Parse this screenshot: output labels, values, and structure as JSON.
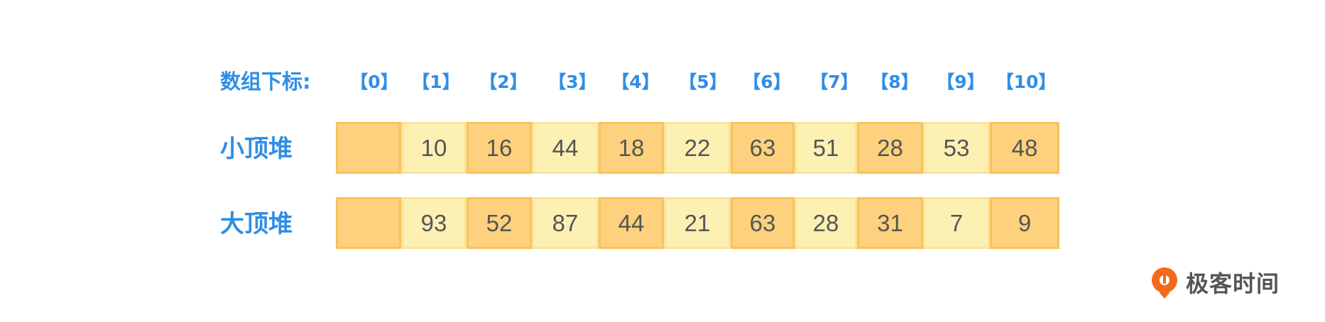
{
  "index_title": "数组下标:",
  "indices": [
    "【0】",
    "【1】",
    "【2】",
    "【3】",
    "【4】",
    "【5】",
    "【6】",
    "【7】",
    "【8】",
    "【9】",
    "【10】"
  ],
  "rows": [
    {
      "label": "小顶堆",
      "values": [
        "",
        "10",
        "16",
        "44",
        "18",
        "22",
        "63",
        "51",
        "28",
        "53",
        "48"
      ]
    },
    {
      "label": "大顶堆",
      "values": [
        "",
        "93",
        "52",
        "87",
        "44",
        "21",
        "63",
        "28",
        "31",
        "7",
        "9"
      ]
    }
  ],
  "logo_text": "极客时间",
  "colors": {
    "label_blue": "#2f8ee6",
    "cell_dark": "#fdd17d",
    "cell_light": "#fdf0b3",
    "logo_orange": "#f26b1d"
  }
}
